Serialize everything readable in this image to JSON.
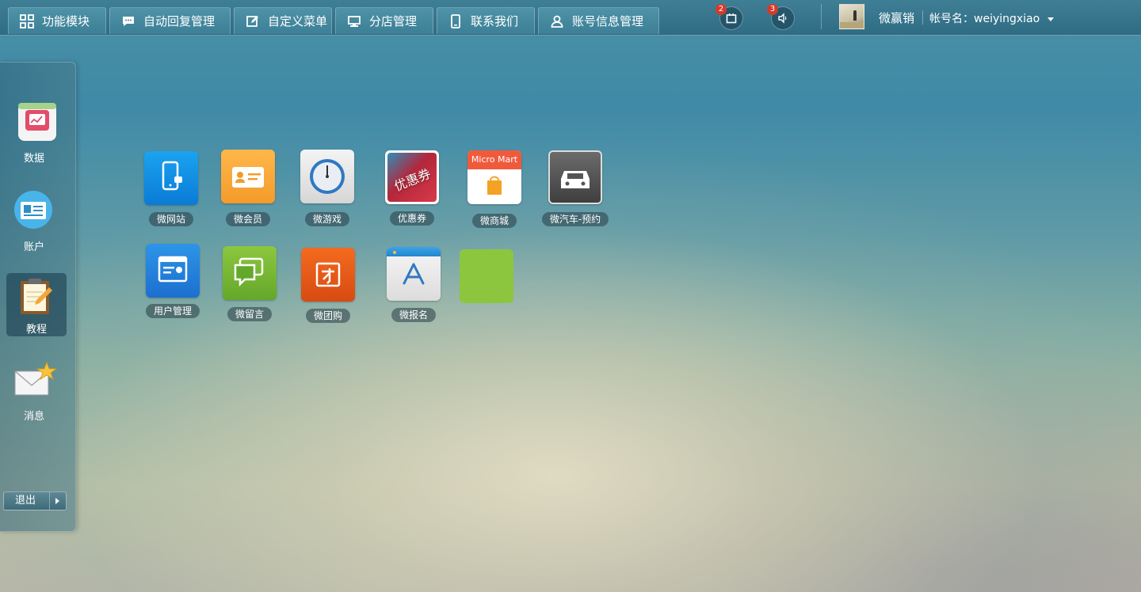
{
  "nav": {
    "tabs": [
      {
        "label": "功能模块",
        "icon": "grid-icon"
      },
      {
        "label": "自动回复管理",
        "icon": "chat-bubble-icon"
      },
      {
        "label": "自定义菜单",
        "icon": "edit-icon"
      },
      {
        "label": "分店管理",
        "icon": "monitor-icon"
      },
      {
        "label": "联系我们",
        "icon": "phone-icon"
      },
      {
        "label": "账号信息管理",
        "icon": "user-icon"
      }
    ]
  },
  "notifications": [
    {
      "count": "2",
      "icon": "calendar-icon"
    },
    {
      "count": "3",
      "icon": "speaker-icon"
    }
  ],
  "user": {
    "name": "微赢销",
    "account_label": "帐号名：weiyingxiao"
  },
  "sidebar": {
    "items": [
      {
        "label": "数据",
        "icon": "chart-icon"
      },
      {
        "label": "账户",
        "icon": "id-card-icon"
      },
      {
        "label": "教程",
        "icon": "notepad-icon"
      },
      {
        "label": "消息",
        "icon": "mail-star-icon"
      }
    ],
    "logout": "退出"
  },
  "apps": [
    {
      "label": "微网站",
      "icon": "mobile-site-icon"
    },
    {
      "label": "微会员",
      "icon": "member-card-icon"
    },
    {
      "label": "微游戏",
      "icon": "game-dial-icon"
    },
    {
      "label": "优惠券",
      "icon": "coupon-icon",
      "tile_text": "优惠券"
    },
    {
      "label": "微商城",
      "icon": "shopping-bag-icon",
      "tile_text": "Micro Mart"
    },
    {
      "label": "微汽车-预约",
      "icon": "car-icon"
    },
    {
      "label": "用户管理",
      "icon": "user-management-icon"
    },
    {
      "label": "微留言",
      "icon": "message-bubbles-icon"
    },
    {
      "label": "微团购",
      "icon": "group-buy-icon"
    },
    {
      "label": "微报名",
      "icon": "app-store-icon"
    },
    {
      "label": "",
      "icon": "blank-tile"
    }
  ],
  "colors": {
    "accent": "#3f7f95",
    "badge": "#d23b2a"
  }
}
